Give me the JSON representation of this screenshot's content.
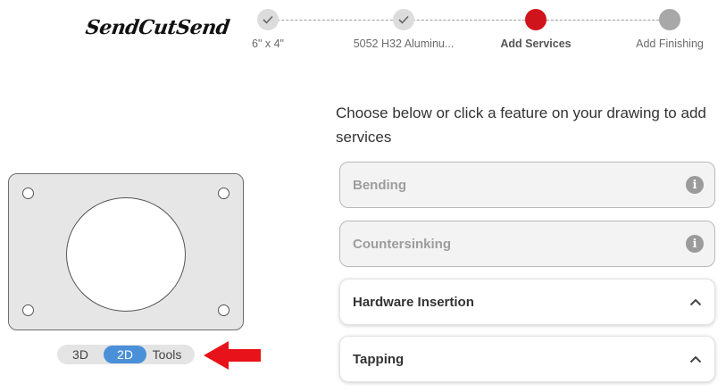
{
  "brand": {
    "logo_text": "SendCutSend"
  },
  "stepper": {
    "steps": [
      {
        "label": "6\" x 4\"",
        "state": "done"
      },
      {
        "label": "5052 H32 Aluminu...",
        "state": "done"
      },
      {
        "label": "Add Services",
        "state": "active"
      },
      {
        "label": "Add Finishing",
        "state": "todo"
      }
    ]
  },
  "viewer": {
    "toggle": {
      "options": [
        "3D",
        "2D",
        "Tools"
      ],
      "selected": "2D"
    }
  },
  "main": {
    "instructions": "Choose below or click a feature on your drawing to add services",
    "services": [
      {
        "label": "Bending",
        "state": "disabled",
        "icon": "info-icon"
      },
      {
        "label": "Countersinking",
        "state": "disabled",
        "icon": "info-icon"
      },
      {
        "label": "Hardware Insertion",
        "state": "enabled",
        "icon": "chevron-up-icon"
      },
      {
        "label": "Tapping",
        "state": "enabled",
        "icon": "chevron-up-icon"
      }
    ]
  },
  "colors": {
    "accent_red": "#d0141c",
    "toggle_blue": "#4a90d9",
    "annotation_arrow": "#e8121a"
  }
}
